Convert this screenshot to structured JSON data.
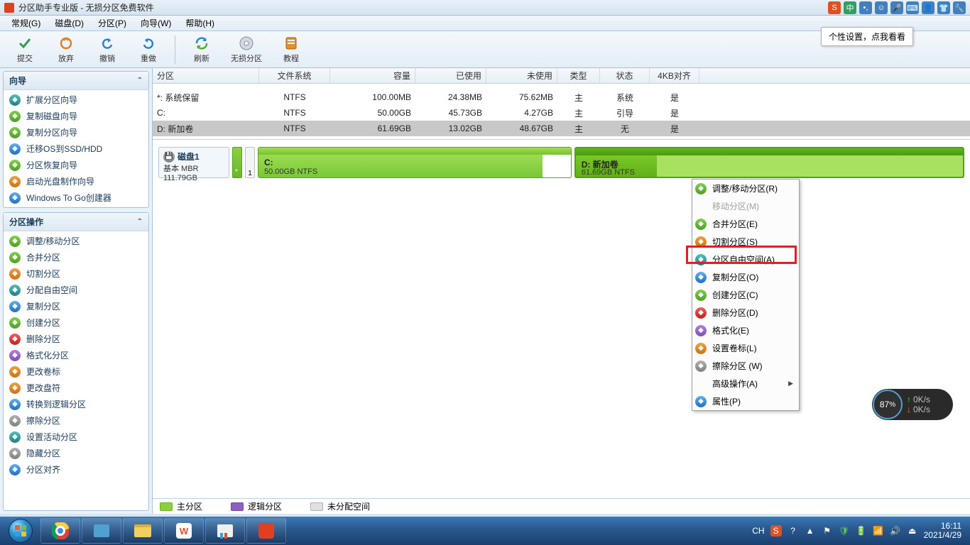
{
  "window": {
    "title": "分区助手专业版 - 无损分区免费软件"
  },
  "menu": {
    "items": [
      "常规(G)",
      "磁盘(D)",
      "分区(P)",
      "向导(W)",
      "帮助(H)"
    ]
  },
  "toolbar": {
    "items": [
      {
        "label": "提交",
        "icon": "check"
      },
      {
        "label": "放弃",
        "icon": "spin"
      },
      {
        "label": "撤销",
        "icon": "undo"
      },
      {
        "label": "重做",
        "icon": "redo"
      },
      {
        "sep": true
      },
      {
        "label": "刷新",
        "icon": "refresh"
      },
      {
        "label": "无损分区",
        "icon": "disk"
      },
      {
        "label": "教程",
        "icon": "book"
      }
    ]
  },
  "panels": {
    "wizard": {
      "title": "向导",
      "items": [
        "扩展分区向导",
        "复制磁盘向导",
        "复制分区向导",
        "迁移OS到SSD/HDD",
        "分区恢复向导",
        "启动光盘制作向导",
        "Windows To Go创建器"
      ]
    },
    "ops": {
      "title": "分区操作",
      "items": [
        "调整/移动分区",
        "合并分区",
        "切割分区",
        "分配自由空间",
        "复制分区",
        "创建分区",
        "删除分区",
        "格式化分区",
        "更改卷标",
        "更改盘符",
        "转换到逻辑分区",
        "擦除分区",
        "设置活动分区",
        "隐藏分区",
        "分区对齐"
      ]
    }
  },
  "table": {
    "headers": [
      "分区",
      "文件系统",
      "容量",
      "已使用",
      "未使用",
      "类型",
      "状态",
      "4KB对齐"
    ],
    "rows": [
      {
        "part": "*: 系统保留",
        "fs": "NTFS",
        "cap": "100.00MB",
        "used": "24.38MB",
        "free": "75.62MB",
        "type": "主",
        "status": "系统",
        "align": "是",
        "selected": false
      },
      {
        "part": "C:",
        "fs": "NTFS",
        "cap": "50.00GB",
        "used": "45.73GB",
        "free": "4.27GB",
        "type": "主",
        "status": "引导",
        "align": "是",
        "selected": false
      },
      {
        "part": "D: 新加卷",
        "fs": "NTFS",
        "cap": "61.69GB",
        "used": "13.02GB",
        "free": "48.67GB",
        "type": "主",
        "status": "无",
        "align": "是",
        "selected": true
      }
    ]
  },
  "disk": {
    "title": "磁盘1",
    "type": "基本 MBR",
    "size": "111.79GB",
    "small_label": "1",
    "seg_c": {
      "title": "C:",
      "sub": "50.00GB NTFS",
      "fillpct": 91
    },
    "seg_d": {
      "title": "D: 新加卷",
      "sub": "61.69GB NTFS",
      "fillpct": 21
    }
  },
  "context": {
    "items": [
      {
        "label": "调整/移动分区(R)",
        "icon": "green"
      },
      {
        "label": "移动分区(M)",
        "disabled": true
      },
      {
        "label": "合并分区(E)",
        "icon": "green"
      },
      {
        "label": "切割分区(S)",
        "icon": "orange"
      },
      {
        "label": "分区自由空间(A)",
        "icon": "teal",
        "highlight": true
      },
      {
        "label": "复制分区(O)",
        "icon": "blue"
      },
      {
        "label": "创建分区(C)",
        "icon": "green"
      },
      {
        "label": "删除分区(D)",
        "icon": "red"
      },
      {
        "label": "格式化(E)",
        "icon": "purple"
      },
      {
        "label": "设置卷标(L)",
        "icon": "orange"
      },
      {
        "label": "擦除分区 (W)",
        "icon": "gray"
      },
      {
        "label": "高级操作(A)",
        "submenu": true
      },
      {
        "label": "属性(P)",
        "icon": "blue"
      }
    ]
  },
  "legend": {
    "primary": "主分区",
    "logical": "逻辑分区",
    "unalloc": "未分配空间"
  },
  "tooltip": {
    "text": "个性设置，点我看看"
  },
  "ime": {
    "badge": "中"
  },
  "speed": {
    "pct": "87",
    "up": "0K/s",
    "down": "0K/s"
  },
  "tray": {
    "lang": "CH",
    "time": "16:11",
    "date": "2021/4/29"
  }
}
